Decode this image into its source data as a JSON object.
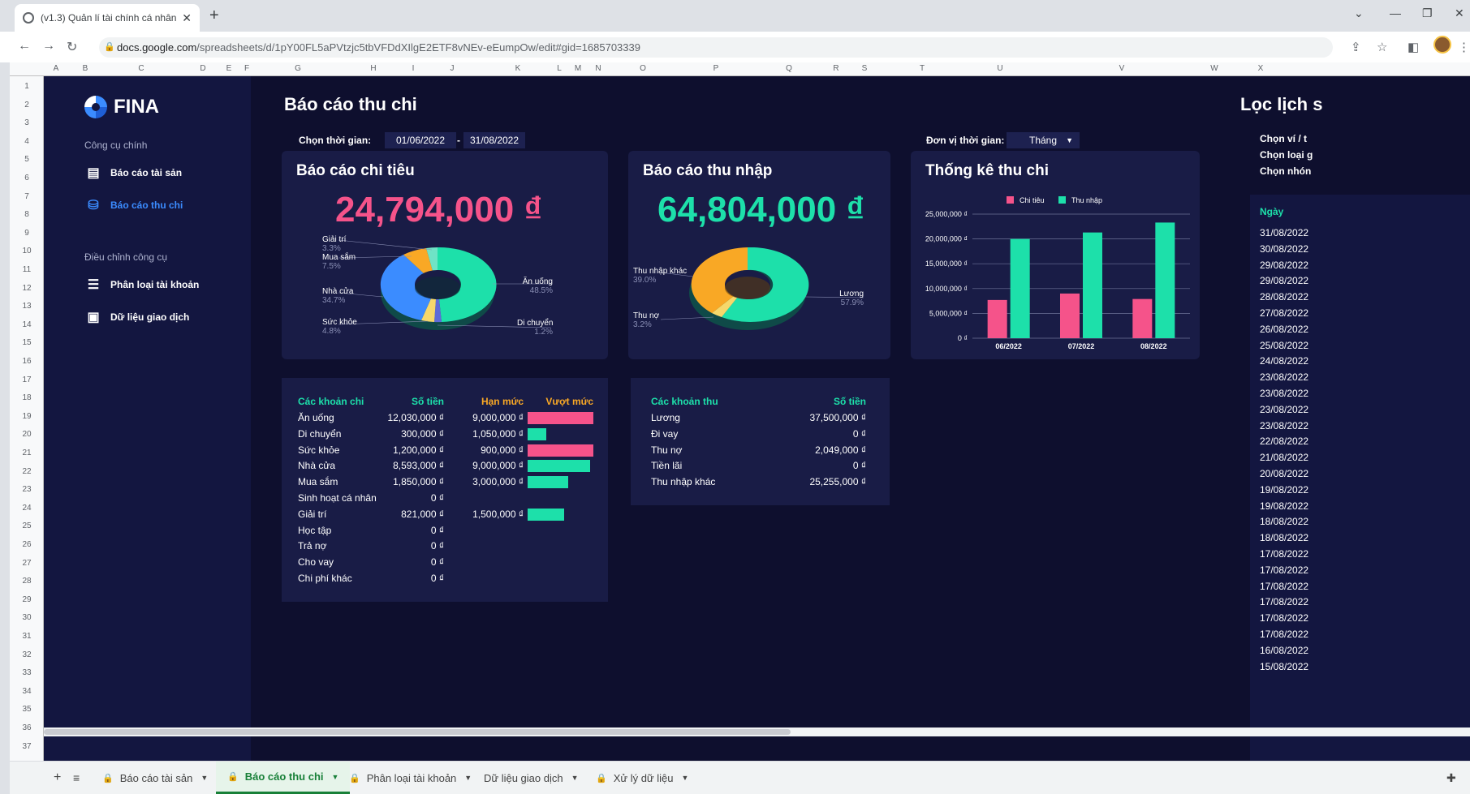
{
  "browser": {
    "tab_title": "(v1.3) Quản lí tài chính cá nhân -",
    "url_host": "docs.google.com",
    "url_path": "/spreadsheets/d/1pY00FL5aPVtzjc5tbVFDdXIlgE2ETF8vNEv-eEumpOw/edit#gid=1685703339"
  },
  "columns": [
    "A",
    "B",
    "C",
    "D",
    "E",
    "F",
    "G",
    "H",
    "I",
    "J",
    "K",
    "L",
    "M",
    "N",
    "O",
    "P",
    "Q",
    "R",
    "S",
    "T",
    "U",
    "V",
    "W",
    "X"
  ],
  "rows": [
    "1",
    "2",
    "3",
    "4",
    "5",
    "6",
    "7",
    "8",
    "9",
    "10",
    "11",
    "12",
    "13",
    "14",
    "15",
    "16",
    "17",
    "18",
    "19",
    "20",
    "21",
    "22",
    "23",
    "24",
    "25",
    "26",
    "27",
    "28",
    "29",
    "30",
    "31",
    "32",
    "33",
    "34",
    "35",
    "36",
    "37"
  ],
  "sidebar": {
    "logo": "FINA",
    "section1": "Công cụ chính",
    "items1": [
      "Báo cáo tài sản",
      "Báo cáo thu chi"
    ],
    "section2": "Điều chỉnh công cụ",
    "items2": [
      "Phân loại tài khoản",
      "Dữ liệu giao dịch"
    ]
  },
  "main": {
    "title": "Báo cáo thu chi",
    "time_label": "Chọn thời gian:",
    "date_from": "01/06/2022",
    "dash": "-",
    "date_to": "31/08/2022",
    "unit_label": "Đơn vị thời gian:",
    "unit_value": "Tháng"
  },
  "expense_card": {
    "title": "Báo cáo chi tiêu",
    "total": "24,794,000 ₫",
    "slices": [
      {
        "name": "Ăn uống",
        "pct": "48.5%"
      },
      {
        "name": "Di chuyển",
        "pct": "1.2%"
      },
      {
        "name": "Sức khỏe",
        "pct": "4.8%"
      },
      {
        "name": "Nhà cửa",
        "pct": "34.7%"
      },
      {
        "name": "Mua sắm",
        "pct": "7.5%"
      },
      {
        "name": "Giải trí",
        "pct": "3.3%"
      }
    ]
  },
  "income_card": {
    "title": "Báo cáo thu nhập",
    "total": "64,804,000 ₫",
    "slices": [
      {
        "name": "Lương",
        "pct": "57.9%"
      },
      {
        "name": "Thu nợ",
        "pct": "3.2%"
      },
      {
        "name": "Thu nhập khác",
        "pct": "39.0%"
      }
    ]
  },
  "chart_data": {
    "type": "bar",
    "title": "Thống kê thu chi",
    "categories": [
      "06/2022",
      "07/2022",
      "08/2022"
    ],
    "series": [
      {
        "name": "Chi tiêu",
        "values": [
          7700000,
          9000000,
          7900000
        ],
        "color": "#f5538a"
      },
      {
        "name": "Thu nhập",
        "values": [
          20000000,
          21300000,
          23300000
        ],
        "color": "#1de0aa"
      }
    ],
    "ylim": [
      0,
      25000000
    ],
    "yticks": [
      "25,000,000 ₫",
      "20,000,000 ₫",
      "15,000,000 ₫",
      "10,000,000 ₫",
      "5,000,000 ₫",
      "0 ₫"
    ],
    "legend": "top",
    "grid": true
  },
  "expense_table": {
    "headers": [
      "Các khoản chi",
      "Số tiền",
      "Hạn mức",
      "Vượt mức"
    ],
    "rows": [
      {
        "name": "Ăn uống",
        "amount": "12,030,000 ₫",
        "limit": "9,000,000 ₫",
        "usage": 1.0,
        "over": true
      },
      {
        "name": "Di chuyển",
        "amount": "300,000 ₫",
        "limit": "1,050,000 ₫",
        "usage": 0.29,
        "over": false
      },
      {
        "name": "Sức khỏe",
        "amount": "1,200,000 ₫",
        "limit": "900,000 ₫",
        "usage": 1.0,
        "over": true
      },
      {
        "name": "Nhà cửa",
        "amount": "8,593,000 ₫",
        "limit": "9,000,000 ₫",
        "usage": 0.95,
        "over": false
      },
      {
        "name": "Mua sắm",
        "amount": "1,850,000 ₫",
        "limit": "3,000,000 ₫",
        "usage": 0.62,
        "over": false
      },
      {
        "name": "Sinh hoạt cá nhân",
        "amount": "0 ₫",
        "limit": "",
        "usage": 0,
        "over": false
      },
      {
        "name": "Giải trí",
        "amount": "821,000 ₫",
        "limit": "1,500,000 ₫",
        "usage": 0.55,
        "over": false
      },
      {
        "name": "Học tập",
        "amount": "0 ₫",
        "limit": "",
        "usage": 0,
        "over": false
      },
      {
        "name": "Trả nợ",
        "amount": "0 ₫",
        "limit": "",
        "usage": 0,
        "over": false
      },
      {
        "name": "Cho vay",
        "amount": "0 ₫",
        "limit": "",
        "usage": 0,
        "over": false
      },
      {
        "name": "Chi phí khác",
        "amount": "0 ₫",
        "limit": "",
        "usage": 0,
        "over": false
      }
    ]
  },
  "income_table": {
    "headers": [
      "Các khoản thu",
      "Số tiền"
    ],
    "rows": [
      {
        "name": "Lương",
        "amount": "37,500,000 ₫"
      },
      {
        "name": "Đi vay",
        "amount": "0 ₫"
      },
      {
        "name": "Thu nợ",
        "amount": "2,049,000 ₫"
      },
      {
        "name": "Tiền lãi",
        "amount": "0 ₫"
      },
      {
        "name": "Thu nhập khác",
        "amount": "25,255,000 ₫"
      }
    ]
  },
  "right_panel": {
    "title": "Lọc lịch s",
    "filters": [
      "Chọn ví / t",
      "Chọn loại g",
      "Chọn nhón"
    ],
    "date_header": "Ngày",
    "dates": [
      "31/08/2022",
      "30/08/2022",
      "29/08/2022",
      "29/08/2022",
      "28/08/2022",
      "27/08/2022",
      "26/08/2022",
      "25/08/2022",
      "24/08/2022",
      "23/08/2022",
      "23/08/2022",
      "23/08/2022",
      "23/08/2022",
      "22/08/2022",
      "21/08/2022",
      "20/08/2022",
      "19/08/2022",
      "19/08/2022",
      "18/08/2022",
      "18/08/2022",
      "17/08/2022",
      "17/08/2022",
      "17/08/2022",
      "17/08/2022",
      "17/08/2022",
      "17/08/2022",
      "16/08/2022",
      "15/08/2022"
    ]
  },
  "sheet_tabs": [
    "Báo cáo tài sản",
    "Báo cáo thu chi",
    "Phân loại tài khoản",
    "Dữ liệu giao dịch",
    "Xử lý dữ liệu"
  ],
  "colors": {
    "bg": "#0e0f2e",
    "card": "#191c46",
    "accent_blue": "#3b8cff",
    "expense": "#f5538a",
    "income": "#1de0aa",
    "orange": "#f9a825"
  }
}
